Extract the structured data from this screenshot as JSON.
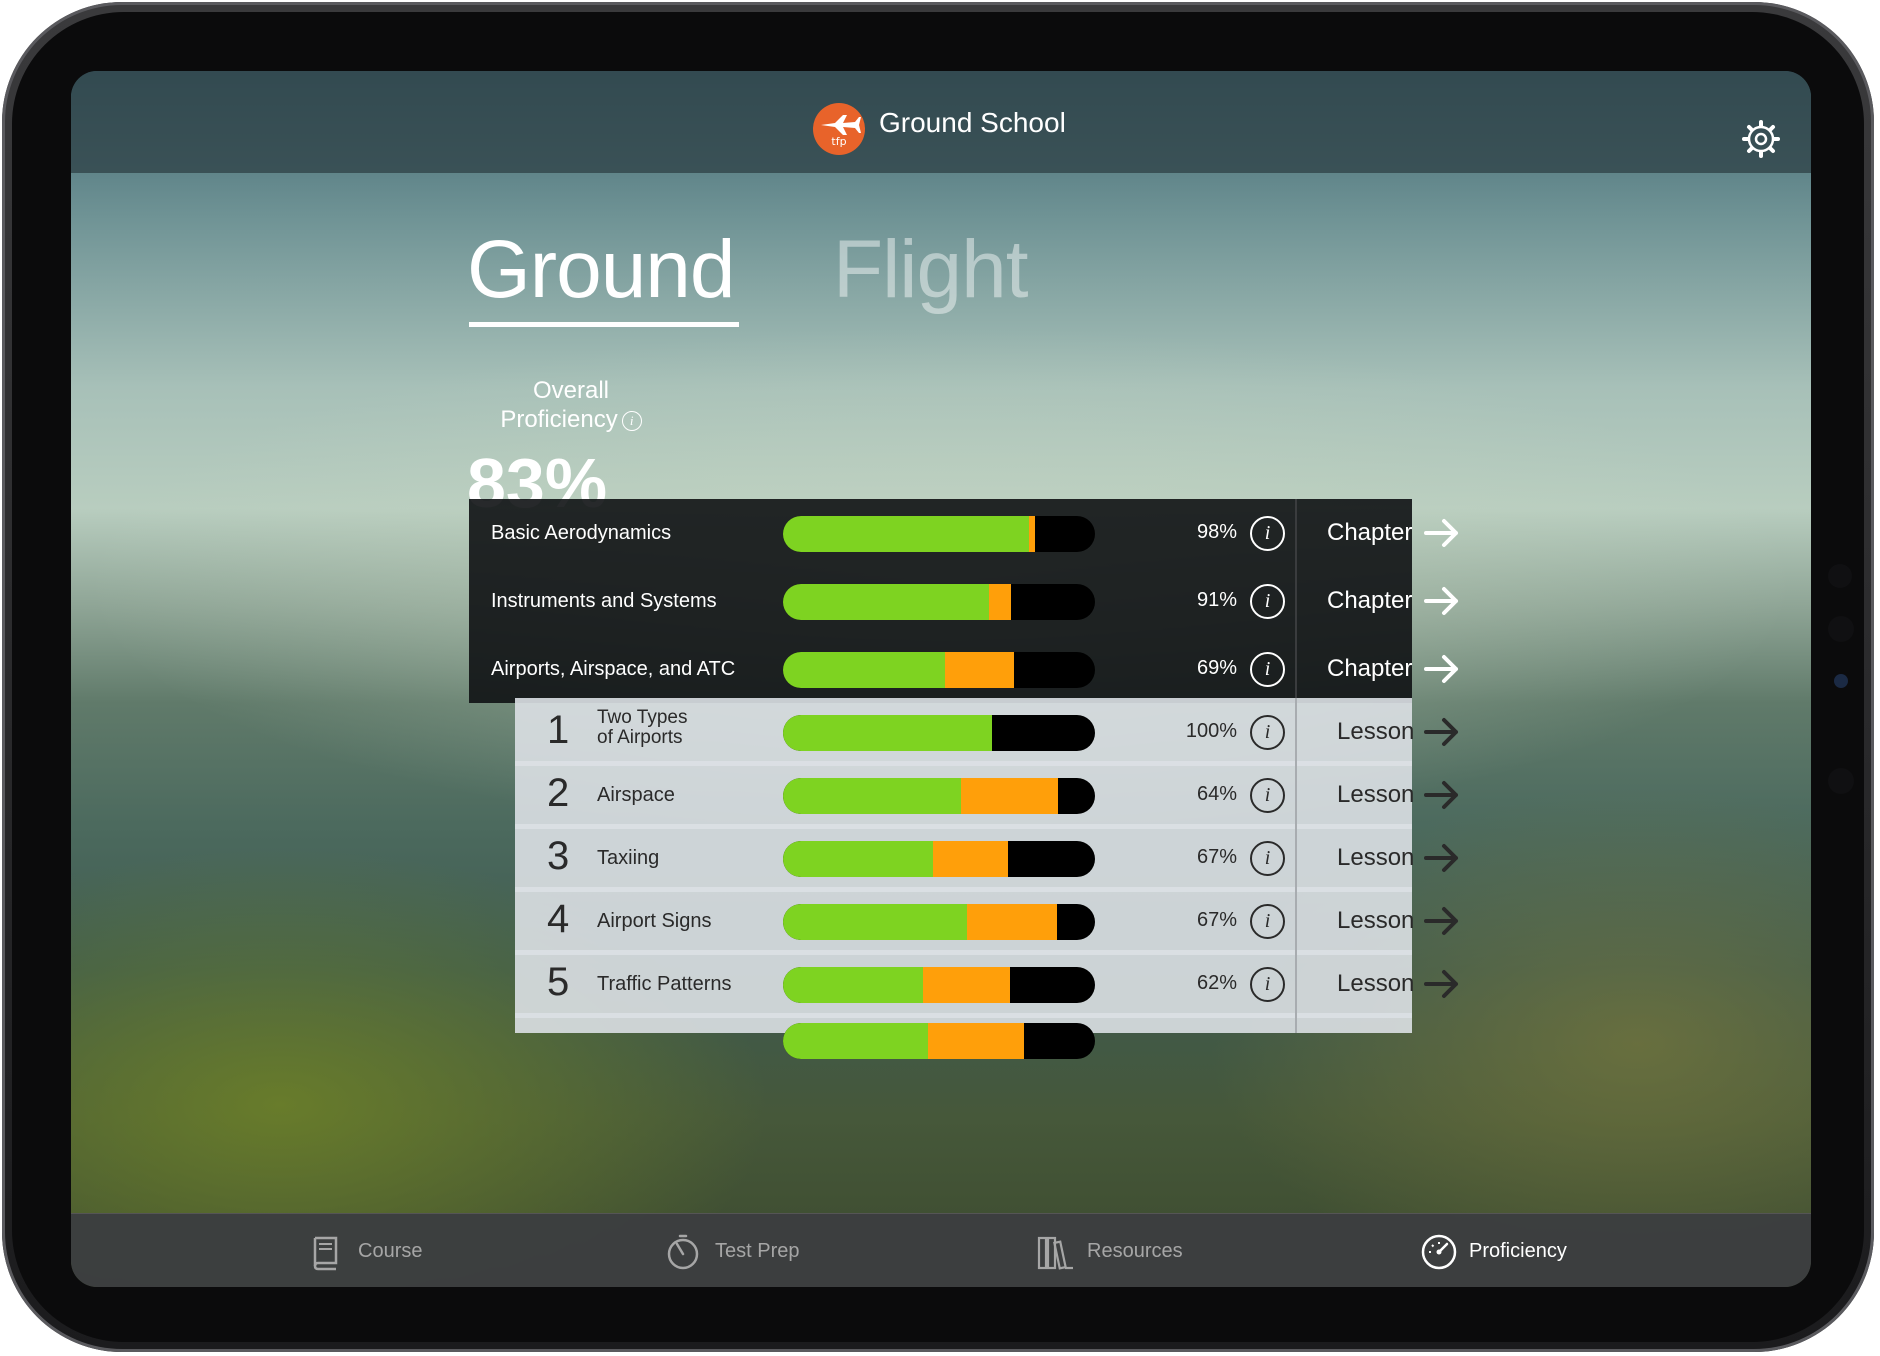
{
  "header": {
    "app_title": "Ground School",
    "logo_text": "tfp"
  },
  "tabs": {
    "ground": "Ground",
    "flight": "Flight"
  },
  "overall": {
    "label_line1": "Overall",
    "label_line2": "Proficiency",
    "value": "83%"
  },
  "info_glyph": "i",
  "chapters": [
    {
      "name": "Basic Aerodynamics",
      "percent": "98%",
      "green": 0.79,
      "orange": 0.02,
      "action": "Chapter"
    },
    {
      "name": "Instruments and Systems",
      "percent": "91%",
      "green": 0.66,
      "orange": 0.07,
      "action": "Chapter"
    },
    {
      "name": "Airports, Airspace, and ATC",
      "percent": "69%",
      "green": 0.52,
      "orange": 0.22,
      "action": "Chapter"
    }
  ],
  "lessons": [
    {
      "number": "1",
      "name_line1": "Two Types",
      "name_line2": "of Airports",
      "percent": "100%",
      "green": 0.67,
      "orange": 0.0,
      "action": "Lesson"
    },
    {
      "number": "2",
      "name": "Airspace",
      "percent": "64%",
      "green": 0.57,
      "orange": 0.31,
      "action": "Lesson"
    },
    {
      "number": "3",
      "name": "Taxiing",
      "percent": "67%",
      "green": 0.48,
      "orange": 0.24,
      "action": "Lesson"
    },
    {
      "number": "4",
      "name": "Airport Signs",
      "percent": "67%",
      "green": 0.59,
      "orange": 0.29,
      "action": "Lesson"
    },
    {
      "number": "5",
      "name": "Traffic Patterns",
      "percent": "62%",
      "green": 0.45,
      "orange": 0.28,
      "action": "Lesson"
    }
  ],
  "tabbar": [
    {
      "label": "Course",
      "icon": "book-icon"
    },
    {
      "label": "Test Prep",
      "icon": "timer-icon"
    },
    {
      "label": "Resources",
      "icon": "library-icon"
    },
    {
      "label": "Proficiency",
      "icon": "gauge-icon",
      "active": true
    }
  ],
  "colors": {
    "green": "#7ed321",
    "orange": "#ff9f0a",
    "logo": "#e8632a"
  }
}
